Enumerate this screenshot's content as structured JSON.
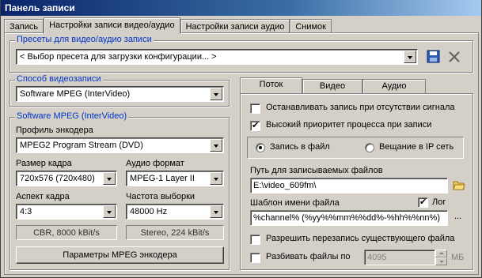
{
  "window": {
    "title": "Панель записи"
  },
  "tabs": [
    "Запись",
    "Настройки записи видео/аудио",
    "Настройки записи аудио",
    "Снимок"
  ],
  "presets": {
    "legend": "Пресеты для видео/аудио записи",
    "selected": "< Выбор пресета для загрузки конфигурации... >"
  },
  "capture_method": {
    "legend": "Способ видеозаписи",
    "selected": "Software MPEG (InterVideo)"
  },
  "software_mpeg": {
    "legend": "Software MPEG (InterVideo)",
    "encoder_profile_label": "Профиль энкодера",
    "encoder_profile": "MPEG2 Program Stream (DVD)",
    "frame_size_label": "Размер кадра",
    "frame_size": "720x576 (720x480)",
    "audio_format_label": "Аудио формат",
    "audio_format": "MPEG-1 Layer II",
    "aspect_label": "Аспект кадра",
    "aspect": "4:3",
    "sample_rate_label": "Частота выборки",
    "sample_rate": "48000 Hz",
    "video_bitrate_info": "CBR, 8000 kBit/s",
    "audio_info": "Stereo, 224 kBit/s",
    "params_button": "Параметры MPEG энкодера"
  },
  "subtabs": [
    "Поток",
    "Видео",
    "Аудио"
  ],
  "stream": {
    "stop_on_no_signal": {
      "label": "Останавливать запись при отсутствии сигнала",
      "checked": false
    },
    "high_priority": {
      "label": "Высокий приоритет процесса при записи",
      "checked": true
    },
    "record_to_file": {
      "label": "Запись в файл",
      "selected": true
    },
    "broadcast_ip": {
      "label": "Вещание в IP сеть",
      "selected": false
    },
    "path_label": "Путь для записываемых файлов",
    "path_value": "E:\\video_609fm\\",
    "template_label": "Шаблон имени файла",
    "log_label": "Лог",
    "log_checked": true,
    "template_value": "%channel% (%yy%%mm%%dd%-%hh%%nn%)",
    "ellipsis": "...",
    "allow_overwrite": {
      "label": "Разрешить перезапись существующего файла",
      "checked": false
    },
    "split_files": {
      "label": "Разбивать файлы по",
      "checked": false
    },
    "split_size": "4095",
    "split_unit": "МБ"
  }
}
